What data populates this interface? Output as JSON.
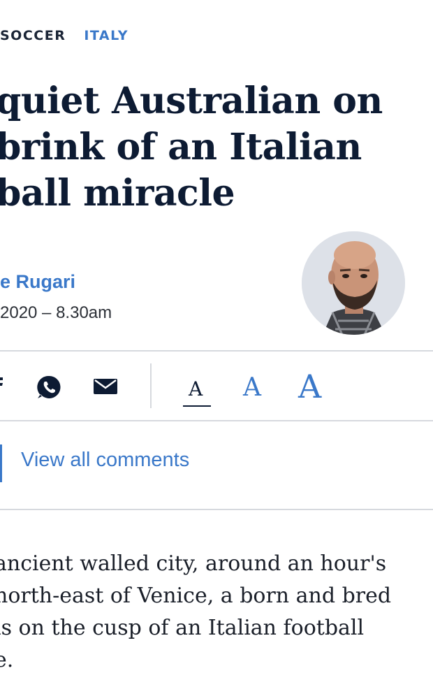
{
  "breadcrumb": {
    "section": "SOCCER",
    "subsection": "ITALY"
  },
  "headline": [
    "quiet Australian on",
    "brink of an Italian",
    "ball miracle"
  ],
  "byline": {
    "author": "e Rugari",
    "date": "2020 – 8.30am"
  },
  "share": {
    "icons": [
      "facebook-icon",
      "whatsapp-icon",
      "email-icon"
    ],
    "font_sizes": [
      "A",
      "A",
      "A"
    ]
  },
  "comments": {
    "label": "View all comments"
  },
  "body": [
    "ancient walled city, around an hour's",
    "north-east of Venice, a born and bred",
    " is on the cusp of an Italian football",
    "e."
  ],
  "colors": {
    "accent": "#3a78c9",
    "headline": "#0d1b33",
    "rule": "#d6d9de"
  }
}
